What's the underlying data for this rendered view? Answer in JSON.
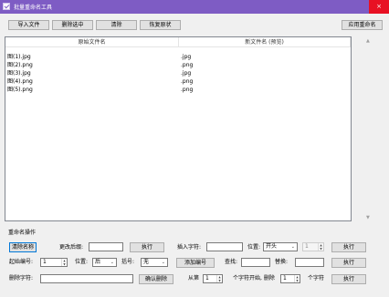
{
  "window": {
    "title": "批量重命名工具",
    "close_glyph": "×"
  },
  "toolbar": {
    "import": "导入文件",
    "remove_selected": "删除选中",
    "clear": "清除",
    "restore": "恢复原状",
    "apply_rename": "应用重命名"
  },
  "table": {
    "columns": [
      "原始文件名",
      "新文件名 (预览)"
    ],
    "rows": [
      {
        "original": "图(1).jpg",
        "preview": ".jpg"
      },
      {
        "original": "图(2).png",
        "preview": ".png"
      },
      {
        "original": "图(3).jpg",
        "preview": ".jpg"
      },
      {
        "original": "图(4).png",
        "preview": ".png"
      },
      {
        "original": "图(5).png",
        "preview": ".png"
      }
    ]
  },
  "ops": {
    "section_title": "重命名操作",
    "row1": {
      "clear_name": "清除名称",
      "change_ext_label": "更改后缀:",
      "execute1": "执行",
      "insert_char_label": "插入字符:",
      "position_label": "位置:",
      "position_value": "开头",
      "position_num": "1",
      "execute2": "执行"
    },
    "row2": {
      "start_num_label": "起始编号:",
      "start_num": "1",
      "position_label": "位置:",
      "position_value": "后",
      "bracket_label": "括号:",
      "bracket_value": "无",
      "add_number": "添加编号",
      "find_label": "查找:",
      "replace_label": "替换:",
      "execute": "执行"
    },
    "row3": {
      "delete_char_label": "删除字符:",
      "confirm_delete": "确认删除",
      "from_label": "从第",
      "from_value": "1",
      "count_mid_label": "个字符开始, 删除",
      "count_value": "1",
      "count_end_label": "个字符",
      "execute": "执行"
    }
  },
  "icons": {
    "app": "app-check-icon",
    "close": "close-icon",
    "spin": "spin-arrows-icon",
    "dropdown": "chevron-down-icon",
    "scroll_up": "scroll-up-icon",
    "scroll_down": "scroll-down-icon"
  },
  "colors": {
    "titlebar": "#7e5cc4",
    "close": "#e81123",
    "window_bg": "#f0f0f0"
  }
}
